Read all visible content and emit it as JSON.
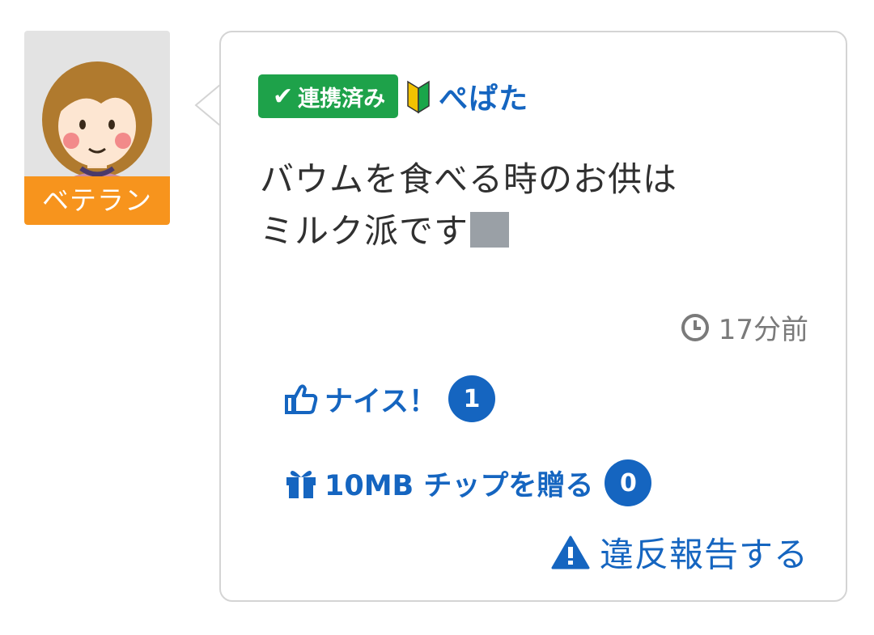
{
  "user": {
    "rank_label": "ベテラン",
    "linked_badge": "連携済み",
    "name": "ぺぱた"
  },
  "post": {
    "message_line1": "バウムを食べる時のお供は",
    "message_line2": "ミルク派です",
    "time_ago": "17分前"
  },
  "actions": {
    "nice_label": "ナイス！",
    "nice_count": "1",
    "tip_label": "10MB チップを贈る",
    "tip_count": "0",
    "report_label": "違反報告する"
  },
  "colors": {
    "accent_blue": "#1565c0",
    "linked_green": "#1ea24a",
    "rank_orange": "#f7941d"
  },
  "icons": [
    "avatar-illustration",
    "v-check-icon",
    "beginner-mark-icon",
    "clock-icon",
    "thumbs-up-icon",
    "gift-icon",
    "warning-icon"
  ]
}
